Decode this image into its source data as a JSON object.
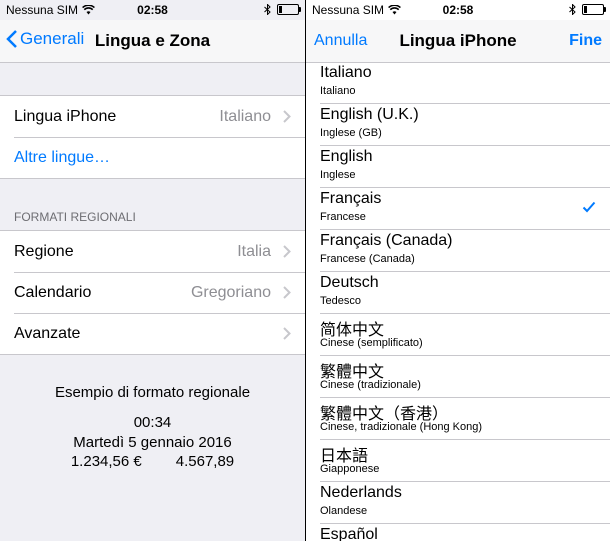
{
  "status": {
    "carrier": "Nessuna SIM",
    "time": "02:58",
    "battery_level": 0.15
  },
  "left": {
    "nav": {
      "back_label": "Generali",
      "title": "Lingua e Zona"
    },
    "language_row": {
      "label": "Lingua iPhone",
      "value": "Italiano"
    },
    "other_languages": "Altre lingue…",
    "section_header": "FORMATI REGIONALI",
    "rows": [
      {
        "label": "Regione",
        "value": "Italia"
      },
      {
        "label": "Calendario",
        "value": "Gregoriano"
      },
      {
        "label": "Avanzate",
        "value": ""
      }
    ],
    "example": {
      "title": "Esempio di formato regionale",
      "time": "00:34",
      "date": "Martedì 5 gennaio 2016",
      "currency": "1.234,56 €",
      "number": "4.567,89"
    }
  },
  "right": {
    "nav": {
      "left_label": "Annulla",
      "title": "Lingua iPhone",
      "right_label": "Fine"
    },
    "languages": [
      {
        "name": "Italiano",
        "sub": "Italiano",
        "selected": false
      },
      {
        "name": "English (U.K.)",
        "sub": "Inglese (GB)",
        "selected": false
      },
      {
        "name": "English",
        "sub": "Inglese",
        "selected": false
      },
      {
        "name": "Français",
        "sub": "Francese",
        "selected": true
      },
      {
        "name": "Français (Canada)",
        "sub": "Francese (Canada)",
        "selected": false
      },
      {
        "name": "Deutsch",
        "sub": "Tedesco",
        "selected": false
      },
      {
        "name": "简体中文",
        "sub": "Cinese (semplificato)",
        "selected": false
      },
      {
        "name": "繁體中文",
        "sub": "Cinese (tradizionale)",
        "selected": false
      },
      {
        "name": "繁體中文（香港）",
        "sub": "Cinese, tradizionale (Hong Kong)",
        "selected": false
      },
      {
        "name": "日本語",
        "sub": "Giapponese",
        "selected": false
      },
      {
        "name": "Nederlands",
        "sub": "Olandese",
        "selected": false
      },
      {
        "name": "Español",
        "sub": "",
        "selected": false
      }
    ]
  },
  "colors": {
    "accent": "#007aff",
    "secondary_text": "#8e8e93",
    "separator": "#c8c7cc",
    "grouped_bg": "#efeff4"
  }
}
